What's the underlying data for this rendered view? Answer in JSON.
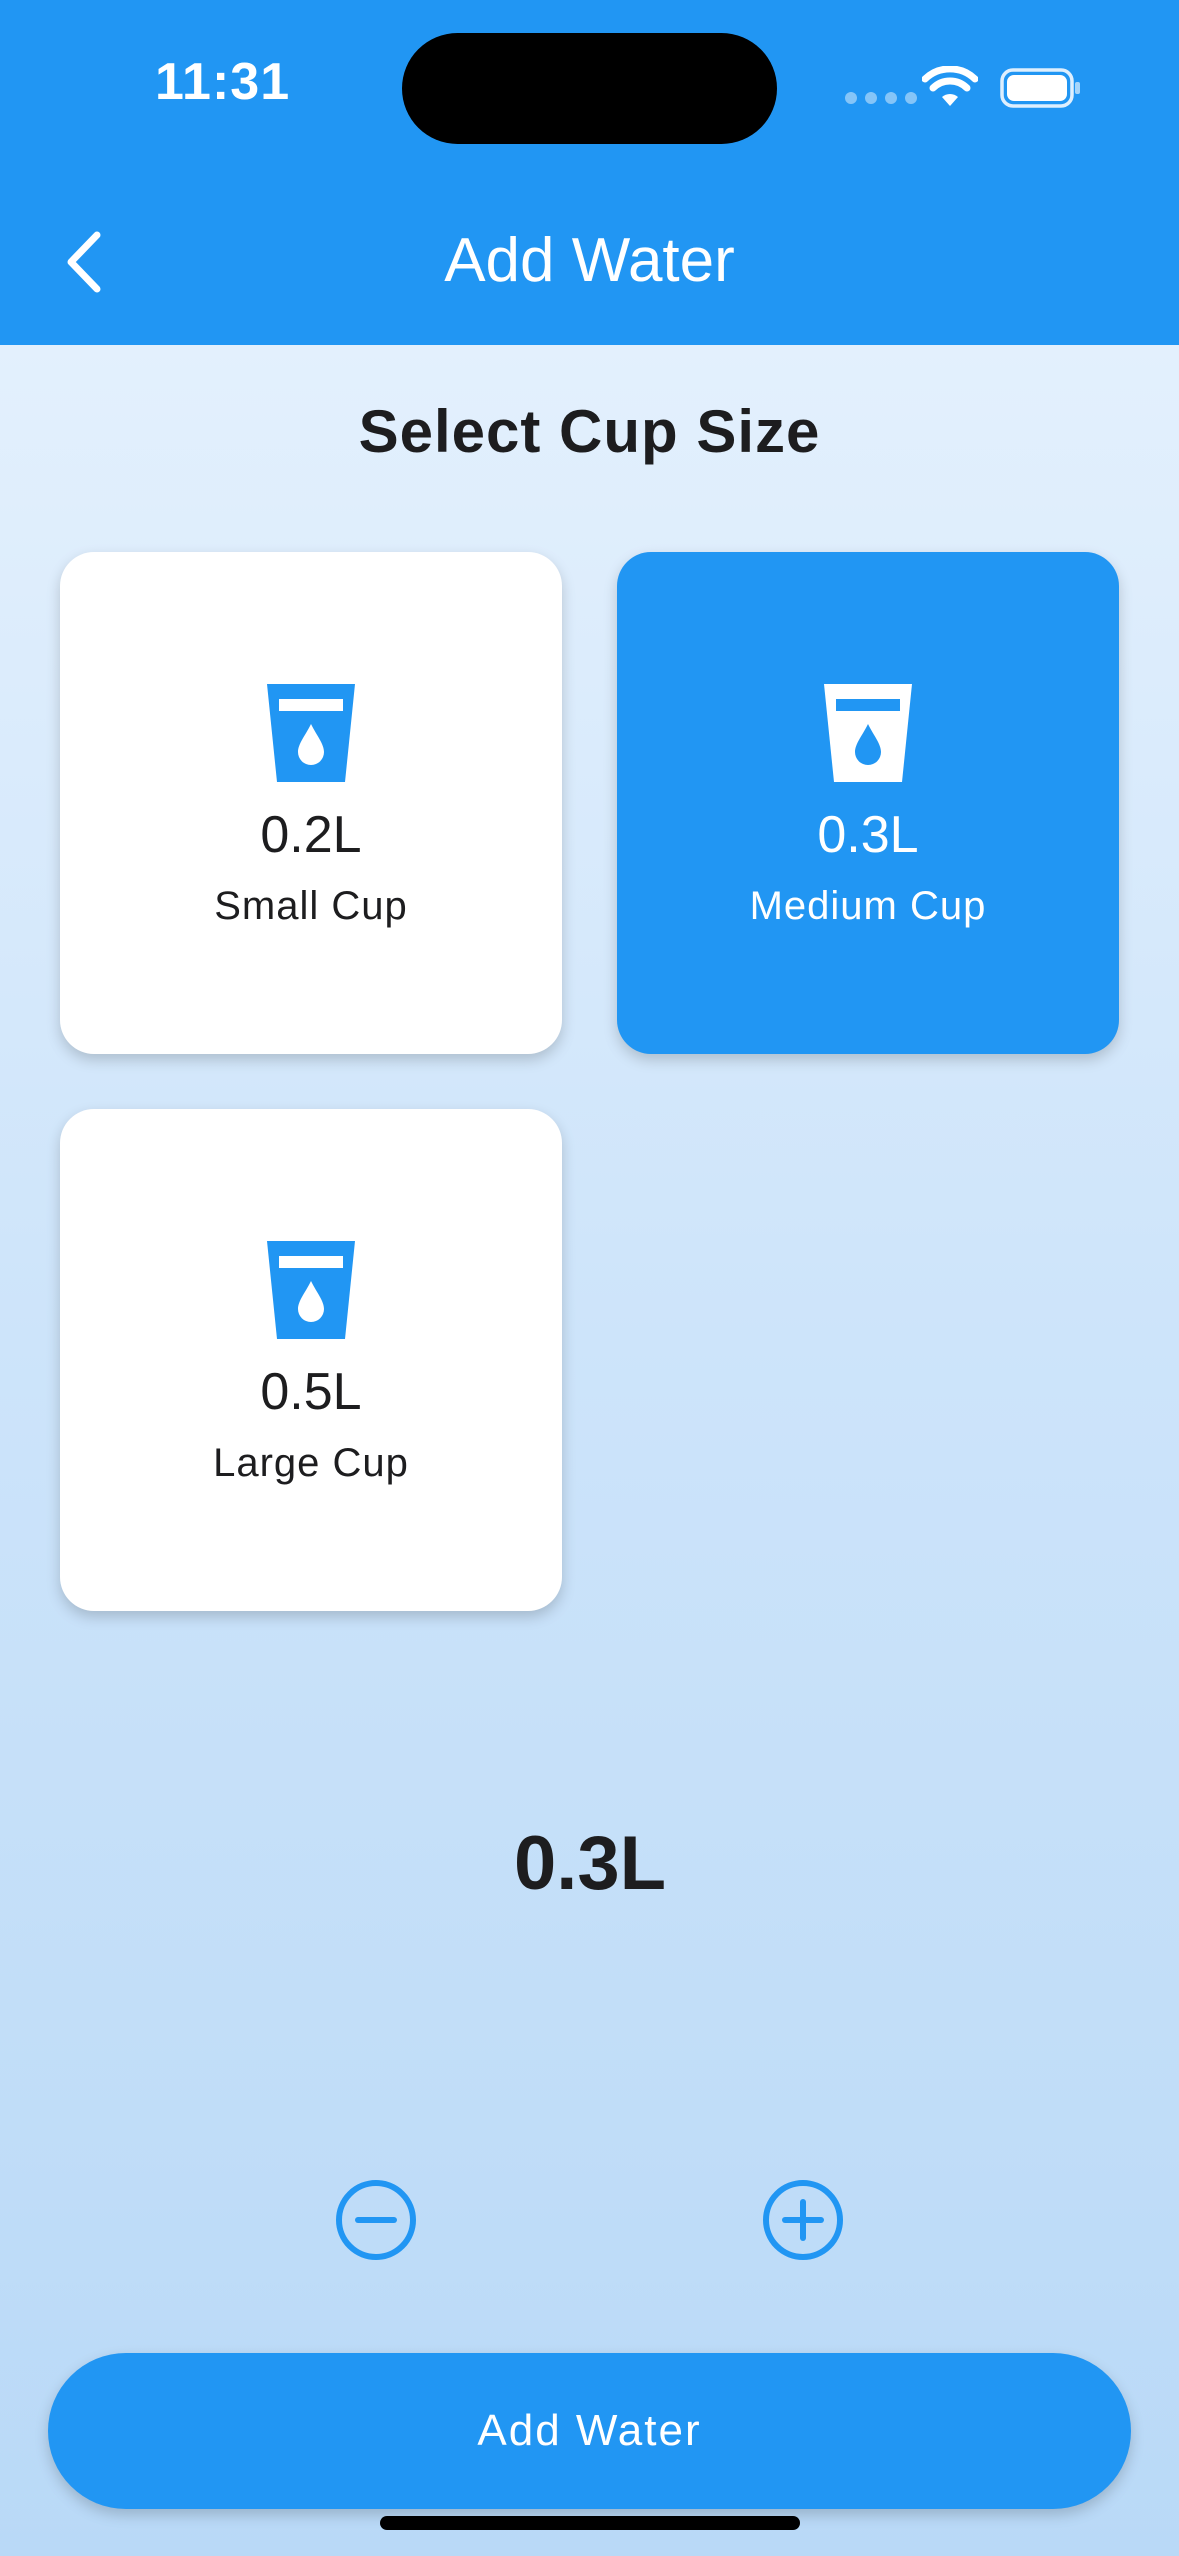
{
  "status_bar": {
    "time": "11:31"
  },
  "header": {
    "title": "Add Water",
    "back_icon": "chevron-left-icon"
  },
  "section": {
    "title": "Select Cup Size"
  },
  "cups": [
    {
      "volume": "0.2L",
      "name": "Small Cup",
      "selected": false,
      "icon": "cup-water-icon"
    },
    {
      "volume": "0.3L",
      "name": "Medium Cup",
      "selected": true,
      "icon": "cup-water-icon"
    },
    {
      "volume": "0.5L",
      "name": "Large Cup",
      "selected": false,
      "icon": "cup-water-icon"
    }
  ],
  "stepper": {
    "value": "0.3L",
    "decrement_icon": "minus-circle-icon",
    "increment_icon": "plus-circle-icon"
  },
  "action": {
    "label": "Add Water"
  },
  "colors": {
    "primary": "#2196F3",
    "text": "#1d1d1f",
    "surface": "#ffffff"
  }
}
